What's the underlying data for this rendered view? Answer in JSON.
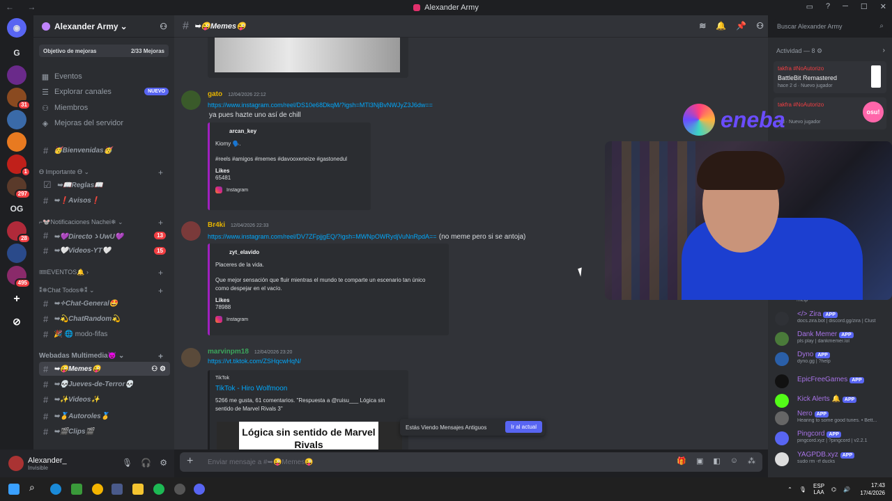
{
  "window": {
    "title": "Alexander Army",
    "controls": [
      "─",
      "☐",
      "✕"
    ]
  },
  "rail": {
    "servers": [
      {
        "label": "G",
        "badge": ""
      },
      {
        "label": "",
        "badge": ""
      },
      {
        "label": "",
        "badge": "31"
      },
      {
        "label": "",
        "badge": ""
      },
      {
        "label": "",
        "badge": ""
      },
      {
        "label": "",
        "badge": "1"
      },
      {
        "label": "",
        "badge": "297"
      },
      {
        "label": "OG",
        "badge": ""
      },
      {
        "label": "",
        "badge": "28"
      },
      {
        "label": "",
        "badge": ""
      },
      {
        "label": "",
        "badge": "495"
      }
    ]
  },
  "server": {
    "name": "Alexander Army",
    "chevron": "⌄"
  },
  "boost": {
    "label": "Objetivo de mejoras",
    "progress": "2/33 Mejoras"
  },
  "menu": [
    {
      "label": "Eventos",
      "icon": "calendar-icon"
    },
    {
      "label": "Explorar canales",
      "icon": "explore-icon",
      "badge": "NUEVO"
    },
    {
      "label": "Miembros",
      "icon": "members-icon"
    },
    {
      "label": "Mejoras del servidor",
      "icon": "boost-icon"
    }
  ],
  "channels": {
    "bienvenidas": "🥳Bienvenidas🥳",
    "cat_importante": "ϴ Importante ϴ ⌄",
    "reglas": "➥📖Reglas📖",
    "avisos": "➥❗Avisos❗",
    "cat_notif": "⌐🐭Notificaciones Nachei❄ ⌄",
    "directo": "➥💜DirectoゝUwU💜",
    "directo_count": "13",
    "videos_yt": "➥🤍Videos-YT🤍",
    "videos_yt_count": "15",
    "cat_eventos": "🎟EVENTOS🔔 ›",
    "cat_chat": "⁑❄Chat Todos❄⁑ ⌄",
    "chat_general": "➥✧Chat-General🤩",
    "chat_random": "➥💫ChatRandom💫",
    "modo_fifas": "🎉 🌐 modo-fifas",
    "cat_webadas": "Webadas Multimedia😈 ⌄",
    "memes": "➥😜Memes😜",
    "jueves": "➥💀Jueves-de-Terror💀",
    "videos": "➥✨Videos✨",
    "autoroles": "➥🥇Autoroles🥇",
    "clips": "➥🎬Clips🎬"
  },
  "user": {
    "name": "Alexander_",
    "status": "Invisible"
  },
  "header": {
    "channel": "➥😜Memes😜"
  },
  "search": {
    "placeholder": "Buscar Alexander Army"
  },
  "messages": [
    {
      "author": "gato",
      "author_color": "#e6b400",
      "timestamp": "12/04/2026 22:12",
      "link": "https://www.instagram.com/reel/DS10e68DkqM/?igsh=MTl3NjBvNWJyZ3J6dw==",
      "text": "ya pues hazte uno así de chill",
      "embed": {
        "author": "arcan_key",
        "desc1": "Kiomy 🗣️.",
        "desc2": "#reels #amigos #memes #davooxeneize #gastonedul",
        "field_name": "Likes",
        "field_value": "65481",
        "footer": "Instagram"
      }
    },
    {
      "author": "Br4ki",
      "author_color": "#e6b400",
      "timestamp": "12/04/2026 22:33",
      "link": "https://www.instagram.com/reel/DV7ZFpjjgEQ/?igsh=MWNpOWRydjVuNnRpdA==",
      "text": "(no meme pero si se antoja)",
      "embed": {
        "author": "zyt_elavido",
        "desc1": "Placeres de la vida.",
        "desc2": "Que mejor sensación que fluir mientras el mundo te comparte un escenario tan único como despejar en el vacío.",
        "field_name": "Likes",
        "field_value": "78988",
        "footer": "Instagram"
      }
    },
    {
      "author": "marvinpm18",
      "author_color": "#3ba55c",
      "timestamp": "12/04/2026 23:20",
      "link": "https://vt.tiktok.com/ZSHqcwHqN/",
      "embed": {
        "provider": "TikTok",
        "title": "TikTok - Hiro Wolfmoon",
        "desc": "5266 me gusta, 61 comentarios. \"Respuesta a @ruisu___ Lógica sin sentido de Marvel Rivals 3\"",
        "thumb_text": "Lógica sin sentido de Marvel Rivals"
      }
    }
  ],
  "oldbar": {
    "label": "Estás Viendo Mensajes Antiguos",
    "button": "Ir al actual"
  },
  "composer": {
    "placeholder": "Enviar mensaje a #➥😜Memes😜"
  },
  "activity": {
    "title": "Actividad — 8 ⚙",
    "cards": [
      {
        "user": "takfra #NoAutorizo",
        "game": "BattleBit Remastered",
        "meta": "hace 2 d",
        "tag": "Nuevo jugador"
      },
      {
        "user": "takfra #NoAutorizo",
        "game": "",
        "meta": "4 d",
        "tag": "Nuevo jugador"
      }
    ]
  },
  "members": [
    {
      "name": "</> Zira",
      "sub": "docs.zira.bot | discord.gg/zira | Clust",
      "app": "APP",
      "av_color": "#2f3136"
    },
    {
      "name": "Dank Memer",
      "sub": "pls play | dankmemer.lol",
      "app": "APP",
      "av_color": "#4a7a3a"
    },
    {
      "name": "Dyno",
      "sub": "dyno.gg | ?help",
      "app": "APP",
      "av_color": "#2a5fa8"
    },
    {
      "name": "EpicFreeGames",
      "sub": "",
      "app": "APP",
      "av_color": "#111111"
    },
    {
      "name": "Kick Alerts 🔔",
      "sub": "",
      "app": "APP",
      "av_color": "#53fc18"
    },
    {
      "name": "Nero",
      "sub": "Hearing to some good tunes. • Bett...",
      "app": "APP",
      "av_color": "#666666"
    },
    {
      "name": "Pingcord",
      "sub": "pingcord.xyz | ?pingcord | v2.2.1",
      "app": "APP",
      "av_color": "#5865f2"
    },
    {
      "name": "YAGPDB.xyz",
      "sub": "sudo rm -rf ducks",
      "app": "APP",
      "av_color": "#dddddd"
    }
  ],
  "member_help": "?help",
  "overlay": {
    "brand": "eneba",
    "osu": "osu!"
  },
  "taskbar": {
    "lang": "ESP\nLAA",
    "time": "17:43",
    "date": "17/4/2026"
  }
}
